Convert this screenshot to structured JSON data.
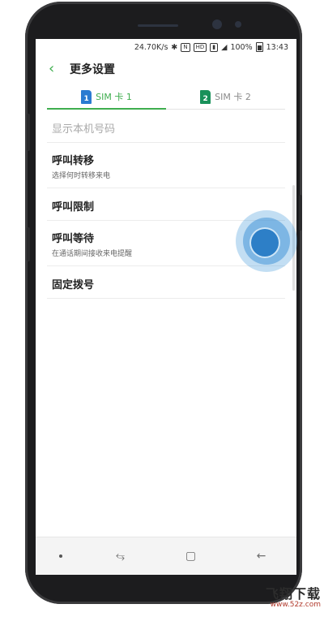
{
  "status_bar": {
    "speed": "24.70K/s",
    "hd": "HD",
    "battery": "100%",
    "time": "13:43"
  },
  "app_bar": {
    "title": "更多设置"
  },
  "tabs": [
    {
      "num": "1",
      "label": "SIM 卡 1",
      "active": true
    },
    {
      "num": "2",
      "label": "SIM 卡 2",
      "active": false
    }
  ],
  "settings": {
    "show_number": "显示本机号码",
    "call_forwarding": {
      "title": "呼叫转移",
      "subtitle": "选择何时转移来电"
    },
    "call_barring": {
      "title": "呼叫限制"
    },
    "call_waiting": {
      "title": "呼叫等待",
      "subtitle": "在通话期间接收来电提醒"
    },
    "fixed_dialing": {
      "title": "固定拨号"
    }
  },
  "watermark": {
    "line1": "飞翔下载",
    "line2": "www.52z.com"
  },
  "colors": {
    "accent": "#3fae4f",
    "touch": "#2d7fc7",
    "sim1": "#2a7bd1",
    "sim2": "#19915a"
  }
}
